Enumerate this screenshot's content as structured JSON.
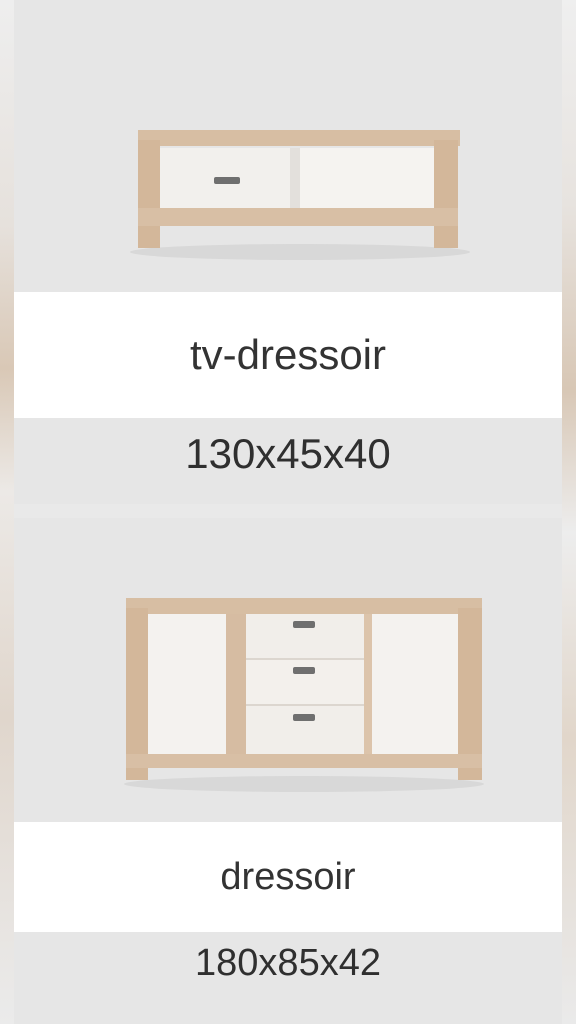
{
  "products": [
    {
      "name": "tv-dressoir",
      "dimensions": "130x45x40"
    },
    {
      "name": "dressoir",
      "dimensions": "180x85x42"
    }
  ],
  "colors": {
    "background": "#e9e9e9",
    "card": "#e6e6e6",
    "name_band": "#ffffff",
    "wood": "#d3b79a",
    "panel": "#f3f1ee",
    "handle": "#6f6f6f",
    "text": "#333333"
  }
}
